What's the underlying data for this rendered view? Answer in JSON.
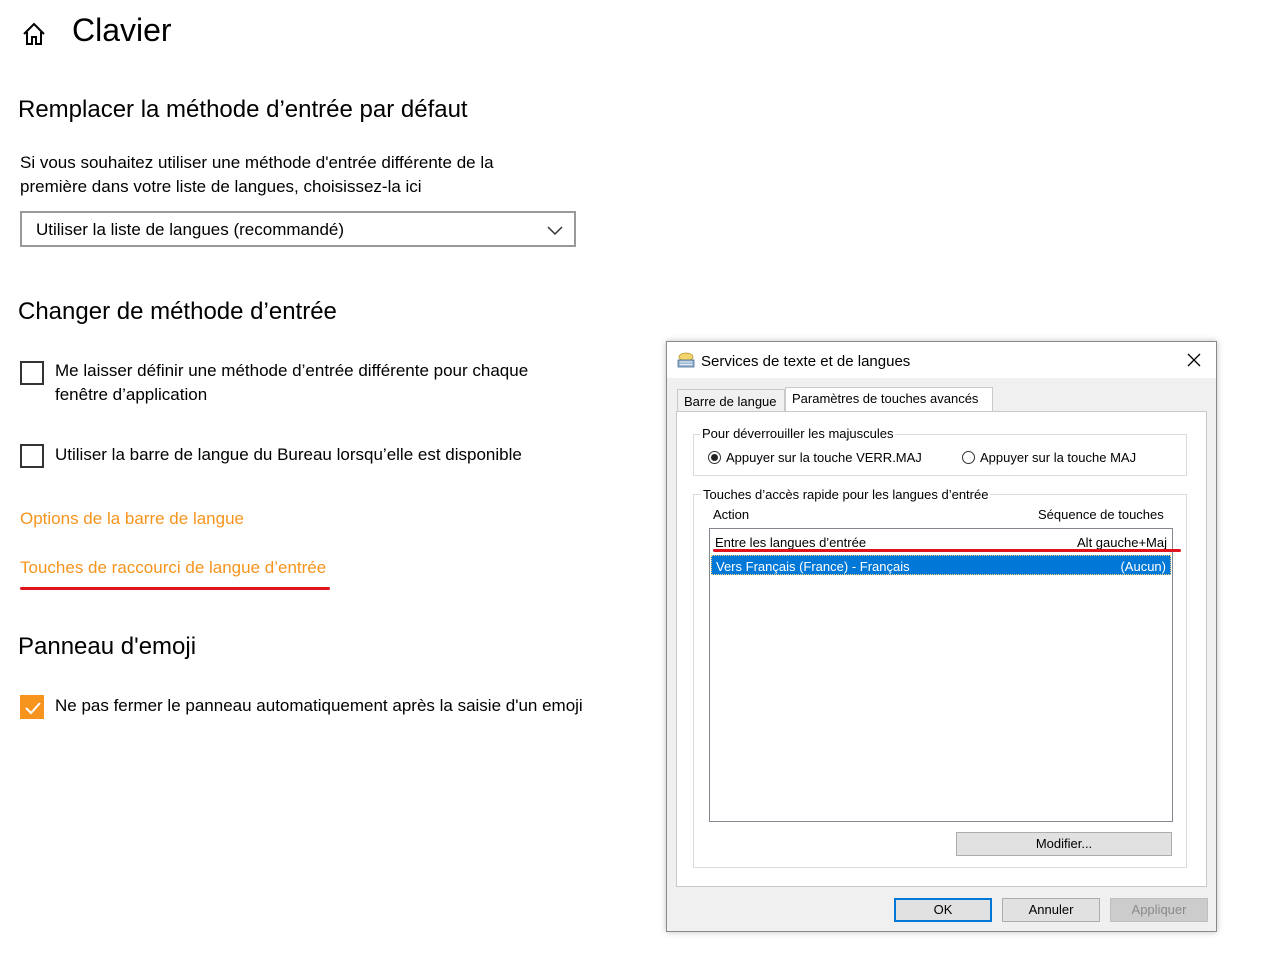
{
  "page": {
    "title": "Clavier",
    "icons": {
      "home": "home-icon",
      "chevron": "chevron-down-icon"
    },
    "accent_color": "#f7941d",
    "annotation_color": "#e0141e"
  },
  "default_input": {
    "heading": "Remplacer la méthode d’entrée par défaut",
    "description_line1": "Si vous souhaitez utiliser une méthode d'entrée différente de la",
    "description_line2": "première dans votre liste de langues, choisissez-la ici",
    "combo_value": "Utiliser la liste de langues (recommandé)"
  },
  "switching": {
    "heading": "Changer de méthode d’entrée",
    "per_app_line1": "Me laisser définir une méthode d’entrée différente pour chaque",
    "per_app_line2": "fenêtre d’application",
    "per_app_checked": false,
    "desktop_bar": "Utiliser la barre de langue du Bureau lorsqu’elle est disponible",
    "desktop_bar_checked": false,
    "link_bar_options": "Options de la barre de langue",
    "link_hotkeys": "Touches de raccourci de langue d’entrée"
  },
  "emoji": {
    "heading": "Panneau d'emoji",
    "keep_open": "Ne pas fermer le panneau automatiquement après la saisie d'un emoji",
    "keep_open_checked": true
  },
  "dialog": {
    "title": "Services de texte et de langues",
    "icons": {
      "app": "keyboard-icon",
      "close": "close-icon"
    },
    "tabs": [
      {
        "label": "Barre de langue",
        "active": false
      },
      {
        "label": "Paramètres de touches avancés",
        "active": true
      }
    ],
    "caps_group": {
      "caption": "Pour déverrouiller les majuscules",
      "option_capslock": "Appuyer sur la touche VERR.MAJ",
      "option_shift": "Appuyer sur la touche MAJ",
      "selected": "capslock"
    },
    "hotkeys_group": {
      "caption": "Touches d’accès rapide pour les langues d’entrée",
      "col_action": "Action",
      "col_sequence": "Séquence de touches",
      "rows": [
        {
          "action": "Entre les langues d’entrée",
          "sequence": "Alt gauche+Maj",
          "selected": false
        },
        {
          "action": "Vers Français (France) - Français",
          "sequence": "(Aucun)",
          "selected": true
        }
      ],
      "modify_button": "Modifier..."
    },
    "buttons": {
      "ok": "OK",
      "cancel": "Annuler",
      "apply": "Appliquer"
    }
  }
}
